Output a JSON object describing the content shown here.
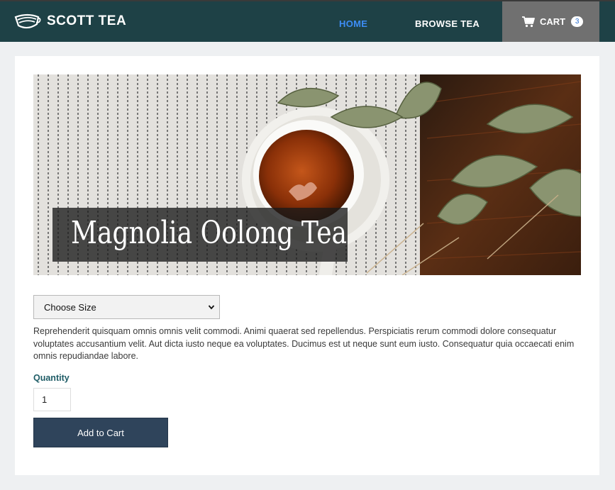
{
  "header": {
    "brand_name": "SCOTT TEA",
    "nav": [
      {
        "label": "HOME",
        "active": true
      },
      {
        "label": "BROWSE TEA",
        "active": false
      }
    ],
    "cart_label": "CART",
    "cart_count": "3",
    "colors": {
      "bar": "#1e4146",
      "active_link": "#3d8df5",
      "cart_bg": "#707070"
    }
  },
  "product": {
    "title": "Magnolia Oolong Tea",
    "size_select": {
      "selected": "Choose Size"
    },
    "description": "Reprehenderit quisquam omnis omnis velit commodi. Animi quaerat sed repellendus. Perspiciatis rerum commodi dolore consequatur voluptates accusantium velit. Aut dicta iusto neque ea voluptates. Ducimus est ut neque sunt eum iusto. Consequatur quia occaecati enim omnis repudiandae labore.",
    "quantity_label": "Quantity",
    "quantity_value": "1",
    "add_to_cart_label": "Add to Cart"
  },
  "icons": {
    "logo": "tea-cup-logo-icon",
    "cart": "shopping-cart-icon",
    "select": "chevron-down-icon"
  }
}
